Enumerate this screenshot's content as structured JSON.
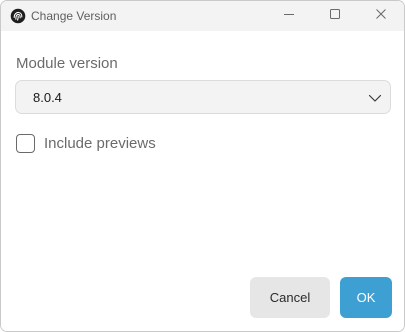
{
  "window": {
    "title": "Change Version",
    "app_icon": "fingerprint-icon",
    "controls": {
      "minimize": "minimize-icon",
      "maximize": "maximize-icon",
      "close": "close-icon"
    }
  },
  "form": {
    "version_label": "Module version",
    "version_selected": "8.0.4",
    "include_previews_label": "Include previews",
    "include_previews_checked": false
  },
  "actions": {
    "cancel_label": "Cancel",
    "ok_label": "OK"
  },
  "colors": {
    "accent": "#3ea0d2",
    "titlebar": "#f3f3f3",
    "cancel_bg": "#e6e6e6"
  }
}
